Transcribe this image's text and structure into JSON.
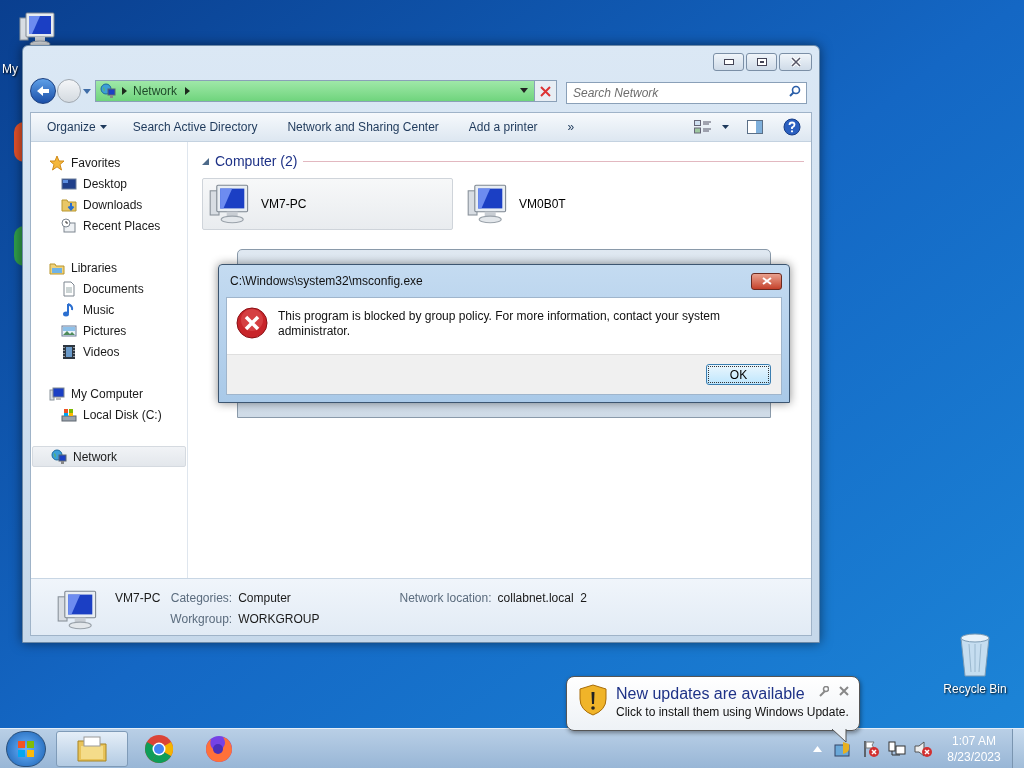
{
  "desktop_icons": [
    {
      "label": "My",
      "kind": "computer"
    },
    {
      "label": "Recycle Bin",
      "kind": "recycle"
    }
  ],
  "explorer": {
    "crumbs": [
      "Network"
    ],
    "search": {
      "placeholder": "Search Network"
    },
    "toolbar": [
      {
        "label": "Organize",
        "kind": "menu"
      },
      {
        "label": "Search Active Directory",
        "kind": "button"
      },
      {
        "label": "Network and Sharing Center",
        "kind": "button"
      },
      {
        "label": "Add a printer",
        "kind": "button"
      },
      {
        "label": "»",
        "kind": "button"
      }
    ],
    "nav": [
      {
        "label": "Favorites",
        "kind": "star",
        "selected": false,
        "children": [
          {
            "label": "Desktop",
            "kind": "desktop",
            "selected": false
          },
          {
            "label": "Downloads",
            "kind": "downloads",
            "selected": false
          },
          {
            "label": "Recent Places",
            "kind": "recent",
            "selected": false
          }
        ]
      },
      {
        "label": "Libraries",
        "kind": "library",
        "selected": false,
        "children": [
          {
            "label": "Documents",
            "kind": "document",
            "selected": false
          },
          {
            "label": "Music",
            "kind": "music",
            "selected": false
          },
          {
            "label": "Pictures",
            "kind": "pictures",
            "selected": false
          },
          {
            "label": "Videos",
            "kind": "video",
            "selected": false
          }
        ]
      },
      {
        "label": "My Computer",
        "kind": "computer",
        "selected": false,
        "children": [
          {
            "label": "Local Disk (C:)",
            "kind": "disk",
            "selected": false
          }
        ]
      },
      {
        "label": "Network",
        "kind": "network",
        "selected": true
      }
    ],
    "group": {
      "title": "Computer (2)"
    },
    "items": [
      {
        "label": "VM7-PC",
        "selected": true
      },
      {
        "label": "VM0B0T",
        "selected": false
      }
    ],
    "details": {
      "name": "VM7-PC",
      "columns": [
        [
          {
            "label": "Categories:",
            "value": "Computer"
          },
          {
            "label": "Workgroup:",
            "value": "WORKGROUP"
          }
        ],
        [
          {
            "label": "Network location:",
            "value": "collabnet.local  2"
          }
        ]
      ]
    }
  },
  "dialog": {
    "title": "C:\\Windows\\system32\\msconfig.exe",
    "message": "This program is blocked by group policy. For more information, contact your system administrator.",
    "buttons": [
      "OK"
    ]
  },
  "notification": {
    "title": "New updates are available",
    "body": "Click to install them using Windows Update."
  },
  "taskbar": {
    "apps": [
      {
        "kind": "explorer",
        "selected": true
      },
      {
        "kind": "chrome",
        "selected": false
      },
      {
        "kind": "firefox",
        "selected": false
      }
    ],
    "clock": {
      "time": "1:07 AM",
      "date": "8/23/2023"
    }
  }
}
